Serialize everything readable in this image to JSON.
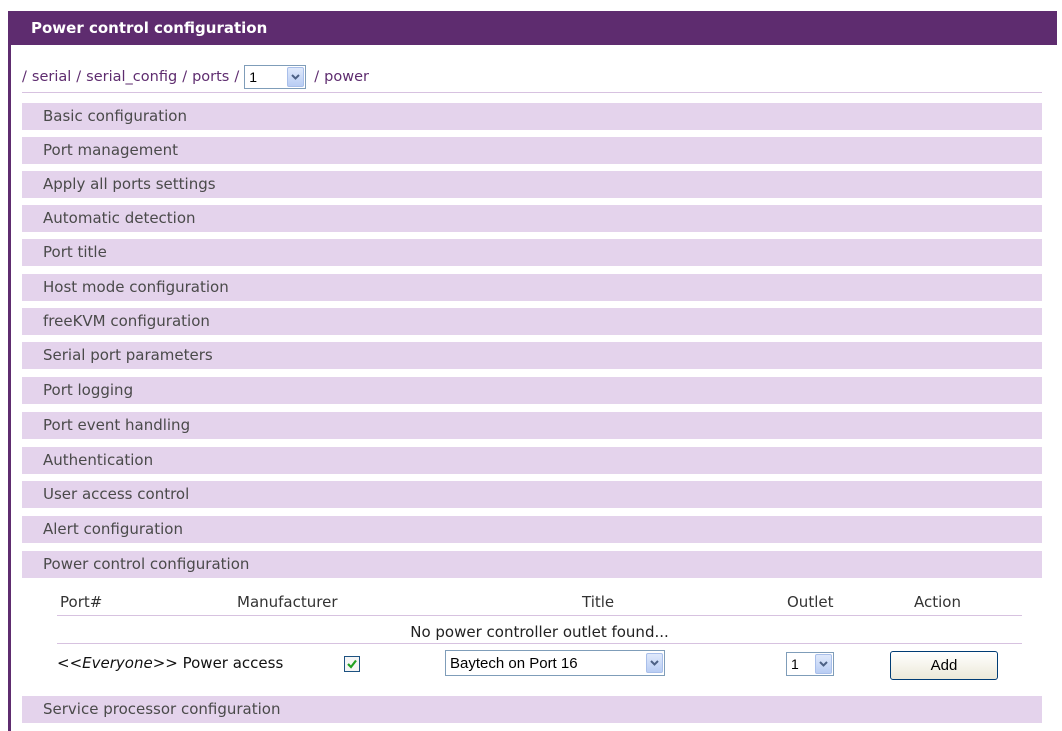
{
  "header": {
    "title": "Power control configuration"
  },
  "breadcrumb": {
    "seg1": "serial",
    "seg2": "serial_config",
    "seg3": "ports",
    "port_value": "1",
    "seg4": "power",
    "separator": "/"
  },
  "sections": {
    "basic": "Basic configuration",
    "port_mgmt": "Port management",
    "apply_all": "Apply all ports settings",
    "auto_detect": "Automatic detection",
    "port_title": "Port title",
    "host_mode": "Host mode configuration",
    "freekvm": "freeKVM configuration",
    "serial_params": "Serial port parameters",
    "port_logging": "Port logging",
    "event_handling": "Port event handling",
    "authentication": "Authentication",
    "user_access": "User access control",
    "alert": "Alert configuration",
    "power": "Power control configuration",
    "service_proc": "Service processor configuration"
  },
  "table": {
    "headers": {
      "port": "Port#",
      "manufacturer": "Manufacturer",
      "title": "Title",
      "outlet": "Outlet",
      "action": "Action"
    },
    "empty_message": "No power controller outlet found...",
    "permission": {
      "prefix": "<<",
      "group": "Everyone",
      "suffix": ">>",
      "label": "Power access",
      "checked": true
    },
    "title_select_value": "Baytech on Port 16",
    "outlet_select_value": "1",
    "add_button": "Add"
  },
  "colors": {
    "accent": "#5e2c6f",
    "section_bg": "#e4d3ec",
    "divider": "#d7c2e0"
  },
  "icons": [
    "chevron-down-icon",
    "checkmark-icon"
  ]
}
